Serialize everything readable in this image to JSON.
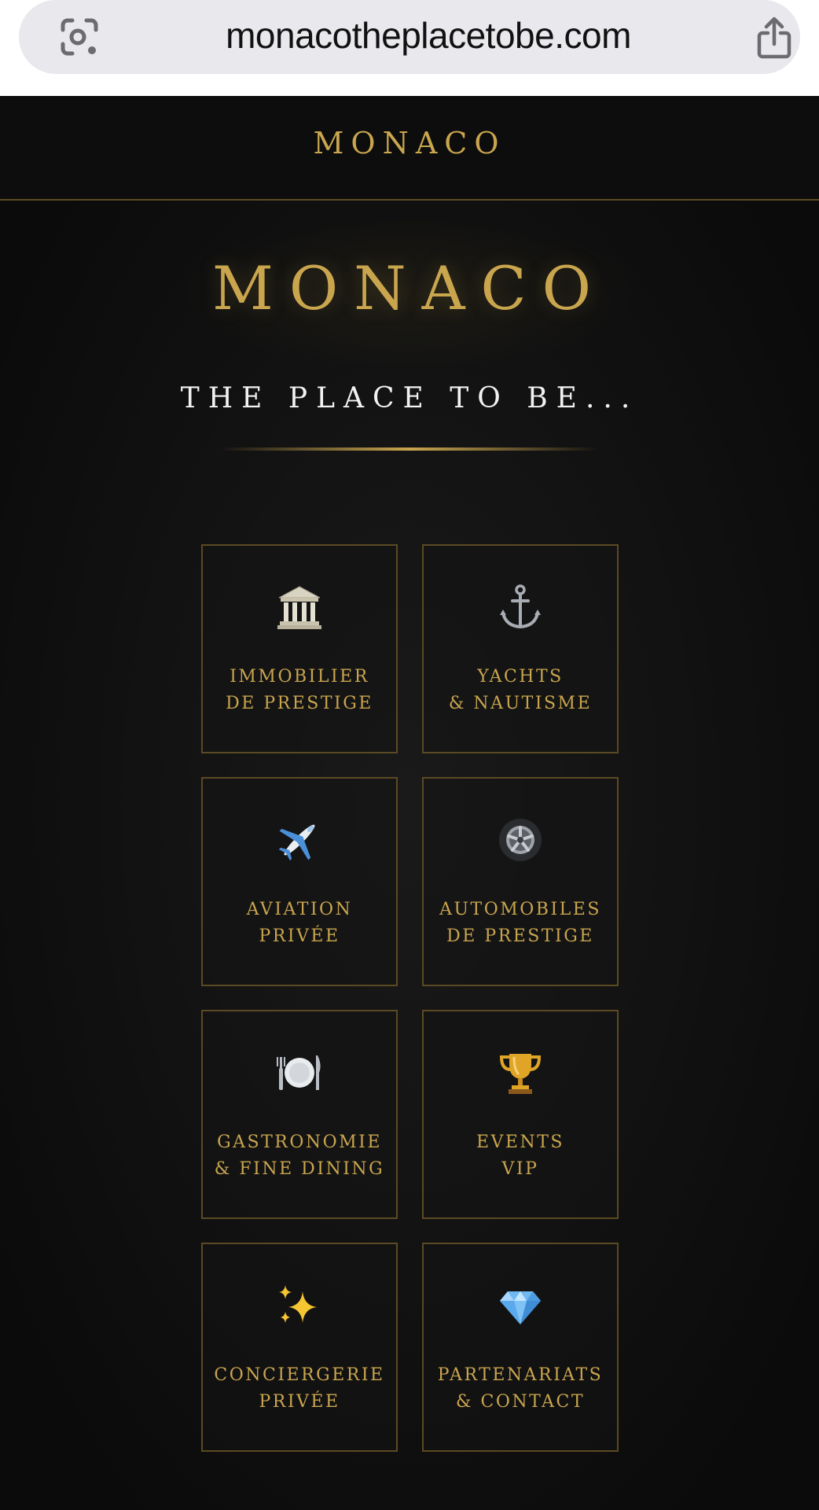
{
  "browser": {
    "url": "monacotheplacetobe.com",
    "left_icon": "lens-icon",
    "right_icon": "share-icon"
  },
  "header": {
    "logo": "MONACO"
  },
  "hero": {
    "title": "MONACO",
    "subtitle": "THE PLACE TO BE..."
  },
  "colors": {
    "gold": "#c9a54e",
    "background": "#111111",
    "card_border": "#5b4a23"
  },
  "cards": [
    {
      "icon": "classical-building-icon",
      "line1": "IMMOBILIER",
      "line2": "DE PRESTIGE"
    },
    {
      "icon": "anchor-icon",
      "line1": "YACHTS",
      "line2": "& NAUTISME"
    },
    {
      "icon": "airplane-icon",
      "line1": "AVIATION",
      "line2": "PRIVÉE"
    },
    {
      "icon": "wheel-icon",
      "line1": "AUTOMOBILES",
      "line2": "DE PRESTIGE"
    },
    {
      "icon": "plate-cutlery-icon",
      "line1": "GASTRONOMIE",
      "line2": "& FINE DINING"
    },
    {
      "icon": "trophy-icon",
      "line1": "EVENTS",
      "line2": "VIP"
    },
    {
      "icon": "sparkles-icon",
      "line1": "CONCIERGERIE",
      "line2": "PRIVÉE"
    },
    {
      "icon": "gem-icon",
      "line1": "PARTENARIATS",
      "line2": "& CONTACT"
    }
  ]
}
